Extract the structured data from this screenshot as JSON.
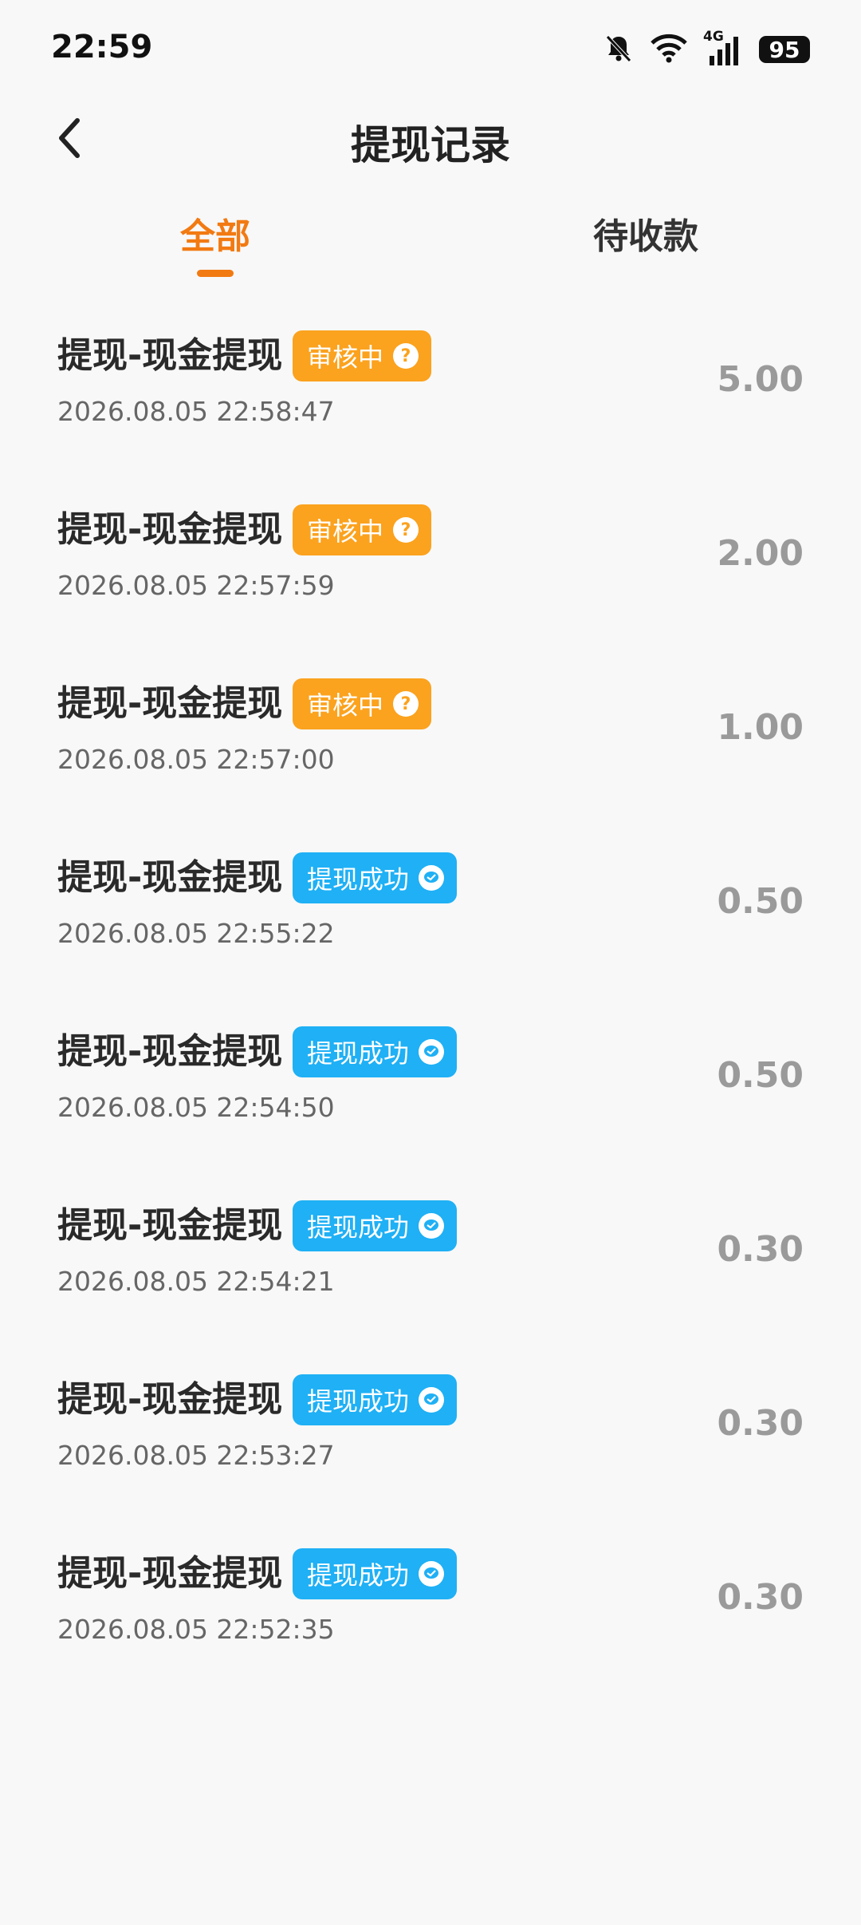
{
  "status_bar": {
    "time": "22:59",
    "battery": "95",
    "network": "4G",
    "icons": [
      "bell-off-icon",
      "wifi-icon",
      "signal-icon",
      "battery-icon"
    ]
  },
  "header": {
    "title": "提现记录",
    "back_icon": "chevron-left-icon"
  },
  "tabs": [
    {
      "label": "全部",
      "active": true
    },
    {
      "label": "待收款",
      "active": false
    }
  ],
  "colors": {
    "accent": "#f27a12",
    "pending_badge": "#fba21e",
    "success_badge": "#1fb0f5",
    "amount": "#9a9a9a"
  },
  "records": [
    {
      "title": "提现-现金提现",
      "status": "审核中",
      "status_type": "pending",
      "status_icon": "question-icon",
      "time": "2026.08.05 22:58:47",
      "amount": "5.00"
    },
    {
      "title": "提现-现金提现",
      "status": "审核中",
      "status_type": "pending",
      "status_icon": "question-icon",
      "time": "2026.08.05 22:57:59",
      "amount": "2.00"
    },
    {
      "title": "提现-现金提现",
      "status": "审核中",
      "status_type": "pending",
      "status_icon": "question-icon",
      "time": "2026.08.05 22:57:00",
      "amount": "1.00"
    },
    {
      "title": "提现-现金提现",
      "status": "提现成功",
      "status_type": "success",
      "status_icon": "wechat-icon",
      "time": "2026.08.05 22:55:22",
      "amount": "0.50"
    },
    {
      "title": "提现-现金提现",
      "status": "提现成功",
      "status_type": "success",
      "status_icon": "wechat-icon",
      "time": "2026.08.05 22:54:50",
      "amount": "0.50"
    },
    {
      "title": "提现-现金提现",
      "status": "提现成功",
      "status_type": "success",
      "status_icon": "wechat-icon",
      "time": "2026.08.05 22:54:21",
      "amount": "0.30"
    },
    {
      "title": "提现-现金提现",
      "status": "提现成功",
      "status_type": "success",
      "status_icon": "wechat-icon",
      "time": "2026.08.05 22:53:27",
      "amount": "0.30"
    },
    {
      "title": "提现-现金提现",
      "status": "提现成功",
      "status_type": "success",
      "status_icon": "wechat-icon",
      "time": "2026.08.05 22:52:35",
      "amount": "0.30"
    }
  ]
}
